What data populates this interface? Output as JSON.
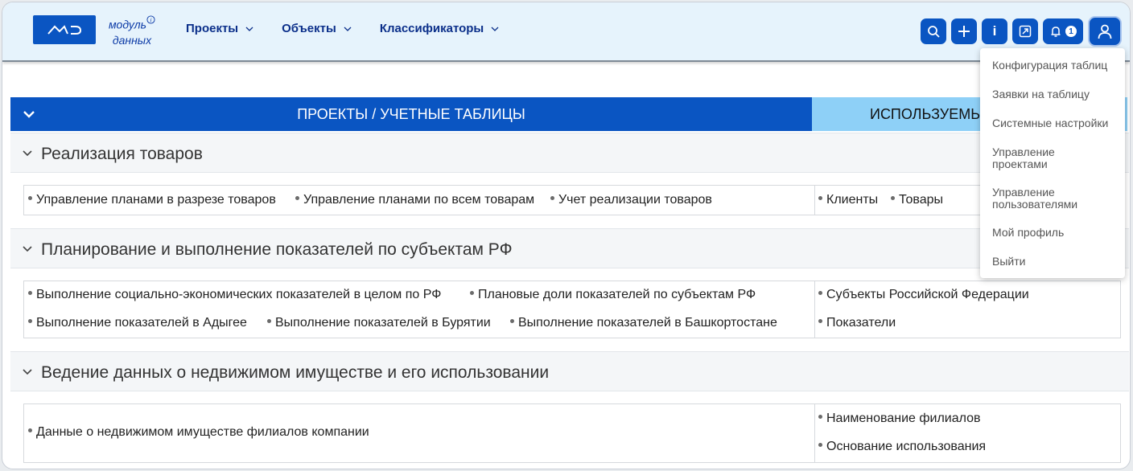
{
  "header": {
    "logo_mark": "МD",
    "logo_line1": "модуль",
    "logo_line2": "данных",
    "logo_info_glyph": "i",
    "nav": [
      {
        "label": "Проекты"
      },
      {
        "label": "Объекты"
      },
      {
        "label": "Классификаторы"
      }
    ],
    "toolbar": {
      "icons": [
        "search-icon",
        "plus-icon",
        "info-icon",
        "expand-icon",
        "bell-icon",
        "user-icon"
      ],
      "info_label": "i",
      "notifications_count": "1"
    }
  },
  "user_menu": {
    "items": [
      {
        "label": "Конфигурация таблиц"
      },
      {
        "label": "Заявки на таблицу"
      },
      {
        "label": "Системные настройки"
      },
      {
        "label": "Управление проектами"
      },
      {
        "label": "Управление пользователями"
      },
      {
        "label": "Мой профиль"
      },
      {
        "label": "Выйти"
      }
    ]
  },
  "table": {
    "left_header": "ПРОЕКТЫ / УЧЕТНЫЕ ТАБЛИЦЫ",
    "right_header": "ИСПОЛЬЗУЕМЫЕ"
  },
  "groups": [
    {
      "title": "Реализация товаров",
      "tables": [
        "Управление планами в разрезе товаров",
        "Управление планами по всем товарам",
        "Учет реализации товаров"
      ],
      "objects": [
        "Клиенты",
        "Товары"
      ]
    },
    {
      "title": "Планирование и выполнение показателей по субъектам РФ",
      "tables": [
        "Выполнение социально-экономических показателей в целом по РФ",
        "Плановые доли показателей по субъектам РФ",
        "Выполнение показателей в Адыгее",
        "Выполнение показателей в Бурятии",
        "Выполнение показателей в Башкортостане"
      ],
      "objects": [
        "Субъекты Российской Федерации",
        "Показатели"
      ]
    },
    {
      "title": "Ведение данных о недвижимом имуществе и его использовании",
      "tables": [
        "Данные о недвижимом имуществе филиалов компании"
      ],
      "objects": [
        "Наименование филиалов",
        "Основание использования"
      ]
    }
  ],
  "colors": {
    "brand_blue": "#0a55c2",
    "header_bg": "#e6f3fc",
    "right_header_bg": "#8ed0f7",
    "nav_text": "#0b2f8a"
  }
}
